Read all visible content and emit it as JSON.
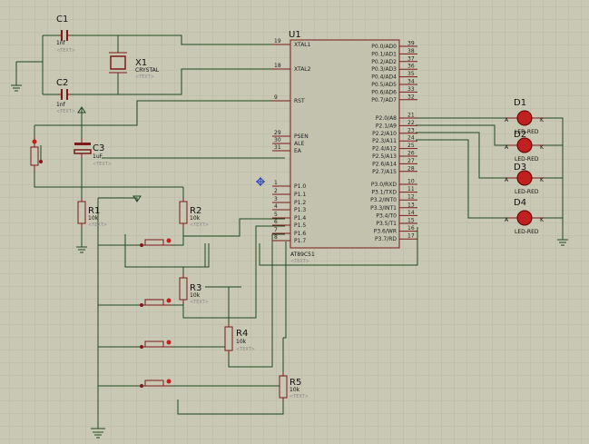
{
  "colors": {
    "background": "#c8c8b4",
    "grid": "#b8b8a4",
    "wire": "#1f4a1f",
    "component": "#7a1a1a",
    "led": "#c02020",
    "text": "#111111"
  },
  "mcu": {
    "ref": "U1",
    "part": "AT89C51",
    "text": "<TEXT>",
    "left_pins": [
      {
        "num": "19",
        "name": "XTAL1"
      },
      {
        "num": "18",
        "name": "XTAL2"
      },
      {
        "num": "9",
        "name": "RST"
      },
      {
        "num": "29",
        "name": "PSEN"
      },
      {
        "num": "30",
        "name": "ALE"
      },
      {
        "num": "31",
        "name": "EA"
      },
      {
        "num": "1",
        "name": "P1.0"
      },
      {
        "num": "2",
        "name": "P1.1"
      },
      {
        "num": "3",
        "name": "P1.2"
      },
      {
        "num": "4",
        "name": "P1.3"
      },
      {
        "num": "5",
        "name": "P1.4"
      },
      {
        "num": "6",
        "name": "P1.5"
      },
      {
        "num": "7",
        "name": "P1.6"
      },
      {
        "num": "8",
        "name": "P1.7"
      }
    ],
    "right_pins": [
      {
        "num": "39",
        "name": "P0.0/AD0"
      },
      {
        "num": "38",
        "name": "P0.1/AD1"
      },
      {
        "num": "37",
        "name": "P0.2/AD2"
      },
      {
        "num": "36",
        "name": "P0.3/AD3"
      },
      {
        "num": "35",
        "name": "P0.4/AD4"
      },
      {
        "num": "34",
        "name": "P0.5/AD5"
      },
      {
        "num": "33",
        "name": "P0.6/AD6"
      },
      {
        "num": "32",
        "name": "P0.7/AD7"
      },
      {
        "num": "21",
        "name": "P2.0/A8"
      },
      {
        "num": "22",
        "name": "P2.1/A9"
      },
      {
        "num": "23",
        "name": "P2.2/A10"
      },
      {
        "num": "24",
        "name": "P2.3/A11"
      },
      {
        "num": "25",
        "name": "P2.4/A12"
      },
      {
        "num": "26",
        "name": "P2.5/A13"
      },
      {
        "num": "27",
        "name": "P2.6/A14"
      },
      {
        "num": "28",
        "name": "P2.7/A15"
      },
      {
        "num": "10",
        "name": "P3.0/RXD"
      },
      {
        "num": "11",
        "name": "P3.1/TXD"
      },
      {
        "num": "12",
        "name": "P3.2/INT0"
      },
      {
        "num": "13",
        "name": "P3.3/INT1"
      },
      {
        "num": "14",
        "name": "P3.4/T0"
      },
      {
        "num": "15",
        "name": "P3.5/T1"
      },
      {
        "num": "16",
        "name": "P3.6/WR"
      },
      {
        "num": "17",
        "name": "P3.7/RD"
      }
    ]
  },
  "capacitors": [
    {
      "ref": "C1",
      "value": "1nf",
      "text": "<TEXT>"
    },
    {
      "ref": "C2",
      "value": "1nf",
      "text": "<TEXT>"
    },
    {
      "ref": "C3",
      "value": "1uF",
      "text": "<TEXT>"
    }
  ],
  "crystal": {
    "ref": "X1",
    "value": "CRYSTAL",
    "text": "<TEXT>"
  },
  "resistors": [
    {
      "ref": "R1",
      "value": "10k",
      "text": "<TEXT>"
    },
    {
      "ref": "R2",
      "value": "10k",
      "text": "<TEXT>"
    },
    {
      "ref": "R3",
      "value": "10k",
      "text": "<TEXT>"
    },
    {
      "ref": "R4",
      "value": "10k",
      "text": "<TEXT>"
    },
    {
      "ref": "R5",
      "value": "10k",
      "text": "<TEXT>"
    }
  ],
  "leds": [
    {
      "ref": "D1",
      "part": "LED-RED",
      "anode": "A",
      "cathode": "K"
    },
    {
      "ref": "D2",
      "part": "LED-RED",
      "anode": "A",
      "cathode": "K"
    },
    {
      "ref": "D3",
      "part": "LED-RED",
      "anode": "A",
      "cathode": "K"
    },
    {
      "ref": "D4",
      "part": "LED-RED",
      "anode": "A",
      "cathode": "K"
    }
  ]
}
